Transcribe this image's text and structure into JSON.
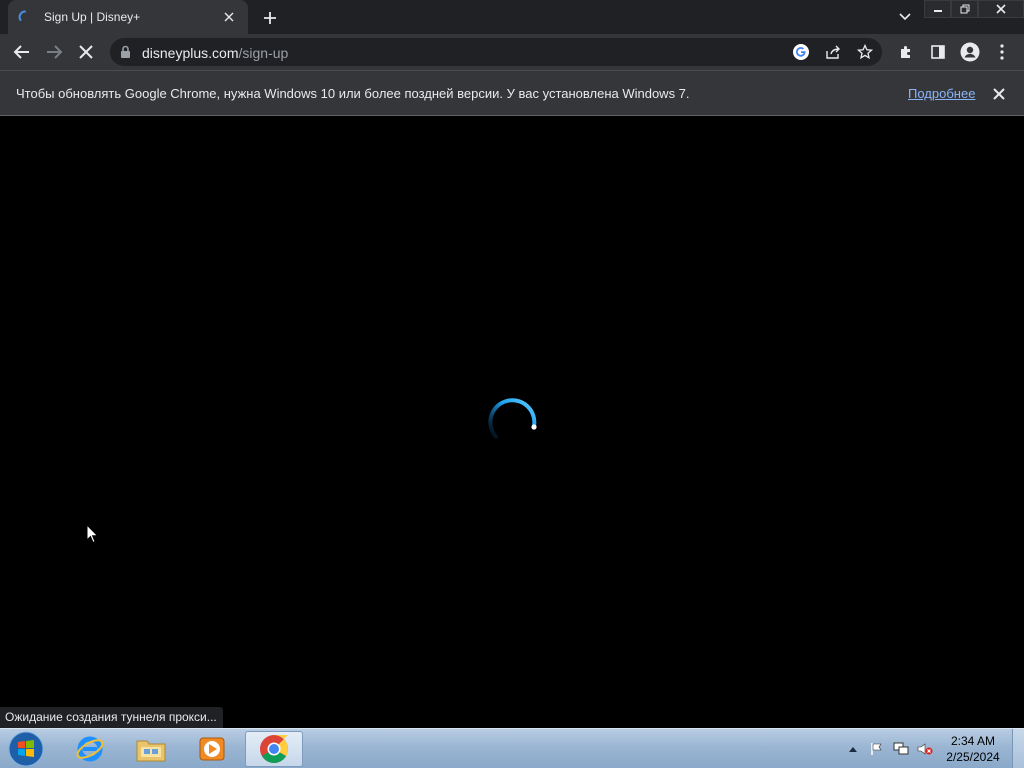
{
  "browser": {
    "tab": {
      "title": "Sign Up | Disney+"
    },
    "window_controls": {
      "minimize": "—",
      "restore": "❐",
      "close": "✕"
    },
    "toolbar": {
      "url_host": "disneyplus.com",
      "url_path": "/sign-up"
    },
    "infobar": {
      "message": "Чтобы обновлять Google Chrome, нужна Windows 10 или более поздней версии. У вас установлена Windows 7.",
      "link": "Подробнее"
    },
    "status": "Ожидание создания туннеля прокси..."
  },
  "taskbar": {
    "clock_time": "2:34 AM",
    "clock_date": "2/25/2024",
    "apps": [
      "internet-explorer",
      "file-explorer",
      "media-player",
      "chrome"
    ]
  },
  "colors": {
    "page_bg": "#000000",
    "chrome_dark": "#202124",
    "chrome_toolbar": "#35363a",
    "link": "#8ab4f8",
    "spinner": "#1da1f2"
  }
}
